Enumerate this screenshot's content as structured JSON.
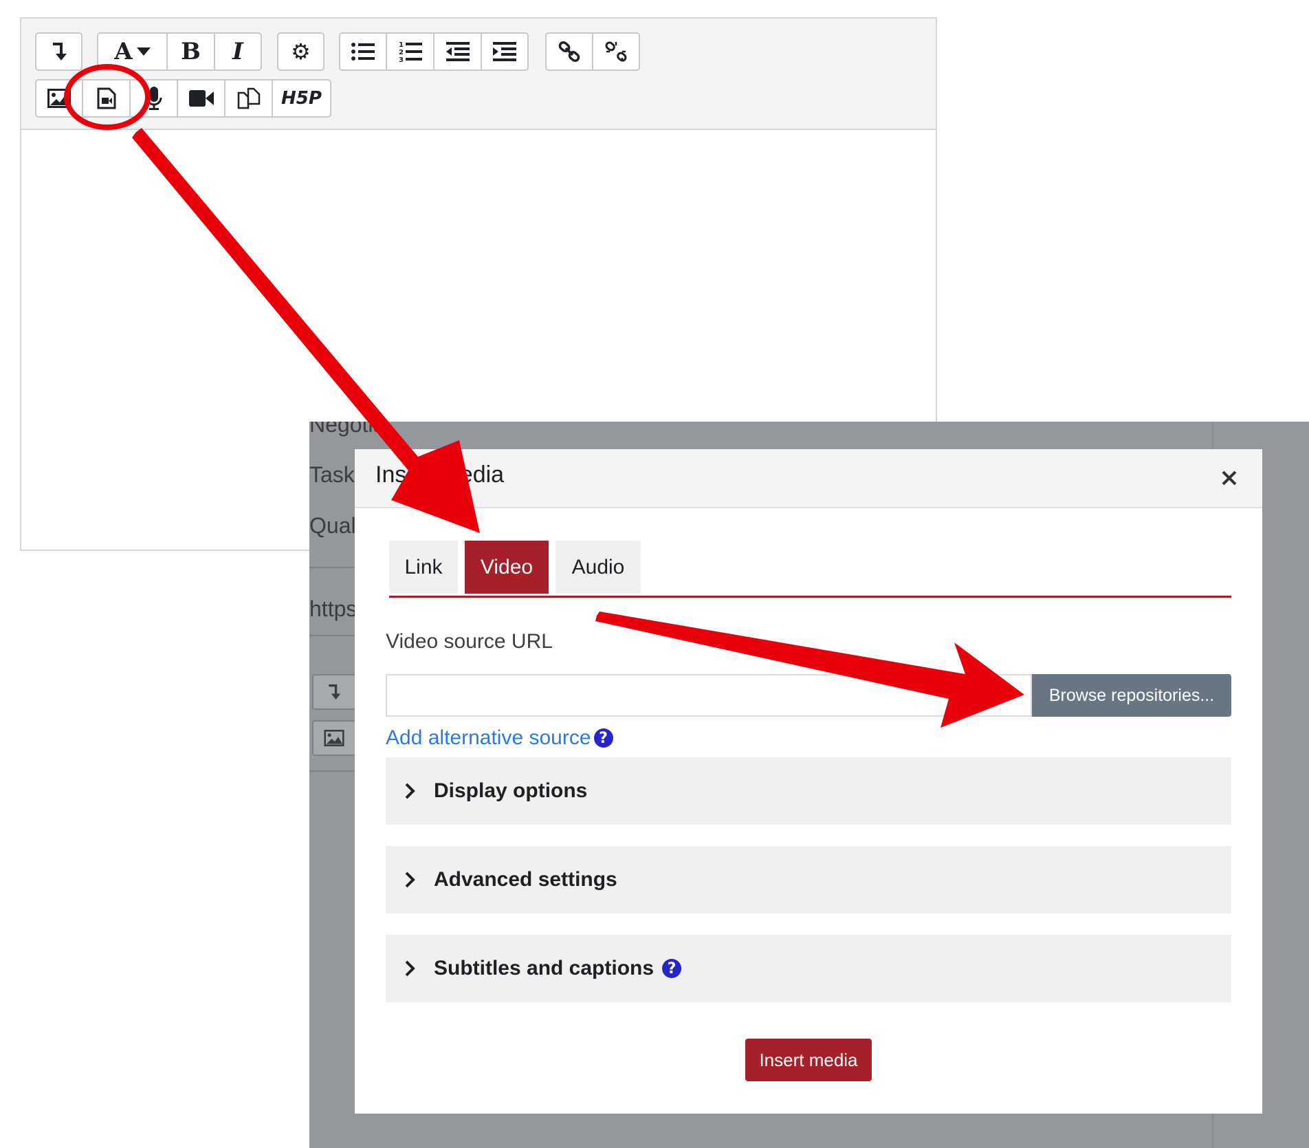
{
  "editor": {
    "toolbar": {
      "row1": [
        {
          "name": "collapse-toggle-button",
          "icon": "arrow-down-return-icon"
        },
        {
          "name": "paragraph-styles-button",
          "icon": "font-dropdown-icon",
          "label": "A"
        },
        {
          "name": "bold-button",
          "icon": "bold-icon",
          "label": "B"
        },
        {
          "name": "italic-button",
          "icon": "italic-icon",
          "label": "I"
        },
        {
          "name": "settings-button",
          "icon": "gear-icon"
        },
        {
          "name": "unordered-list-button",
          "icon": "bullet-list-icon"
        },
        {
          "name": "ordered-list-button",
          "icon": "numbered-list-icon"
        },
        {
          "name": "outdent-button",
          "icon": "outdent-icon"
        },
        {
          "name": "indent-button",
          "icon": "indent-icon"
        },
        {
          "name": "link-button",
          "icon": "link-icon"
        },
        {
          "name": "unlink-button",
          "icon": "unlink-icon"
        }
      ],
      "row2": [
        {
          "name": "insert-image-button",
          "icon": "image-icon"
        },
        {
          "name": "insert-media-button",
          "icon": "media-file-icon"
        },
        {
          "name": "record-audio-button",
          "icon": "microphone-icon"
        },
        {
          "name": "record-video-button",
          "icon": "video-camera-icon"
        },
        {
          "name": "manage-files-button",
          "icon": "copy-files-icon"
        },
        {
          "name": "h5p-button",
          "icon": "h5p-icon",
          "label": "H5P"
        }
      ]
    }
  },
  "background_page": {
    "lines": [
      "Negotia",
      "Task r",
      "Qualit",
      "https"
    ]
  },
  "modal": {
    "title": "Insert media",
    "close_icon": "close-icon",
    "tabs": [
      {
        "label": "Link",
        "active": false
      },
      {
        "label": "Video",
        "active": true
      },
      {
        "label": "Audio",
        "active": false
      }
    ],
    "video_source_label": "Video source URL",
    "video_source_value": "",
    "browse_label": "Browse repositories...",
    "alternative_source_label": "Add alternative source",
    "sections": [
      {
        "label": "Display options",
        "has_help": false
      },
      {
        "label": "Advanced settings",
        "has_help": false
      },
      {
        "label": "Subtitles and captions",
        "has_help": true
      }
    ],
    "insert_label": "Insert media"
  },
  "colors": {
    "accent": "#a6202a",
    "browse_button": "#687583",
    "link": "#2a7ae2",
    "help_icon": "#2626c8",
    "annotation": "#e8000b",
    "backdrop": "#94979c"
  }
}
